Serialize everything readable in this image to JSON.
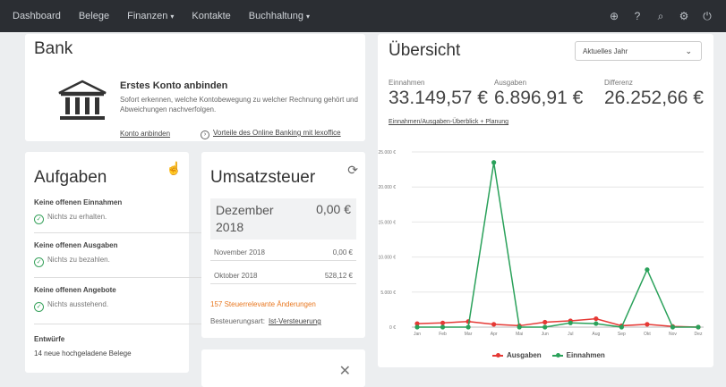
{
  "nav": {
    "items": [
      "Dashboard",
      "Belege",
      "Finanzen",
      "Kontakte",
      "Buchhaltung"
    ],
    "icons": [
      "plus-circle-icon",
      "help-icon",
      "search-icon",
      "settings-icon",
      "power-icon"
    ]
  },
  "bank": {
    "title": "Bank",
    "heading": "Erstes Konto anbinden",
    "description": "Sofort erkennen, welche Kontobewegung zu welcher Rechnung gehört und Abweichungen nachverfolgen.",
    "link_connect": "Konto anbinden",
    "link_online": "Vorteile des Online Banking mit lexoffice"
  },
  "aufgaben": {
    "title": "Aufgaben",
    "tasks": [
      {
        "title": "Keine offenen Einnahmen",
        "status": "Nichts zu erhalten."
      },
      {
        "title": "Keine offenen Ausgaben",
        "status": "Nichts zu bezahlen."
      },
      {
        "title": "Keine offenen Angebote",
        "status": "Nichts ausstehend."
      }
    ],
    "entwuerfe_title": "Entwürfe",
    "entwuerfe_value": "14  neue hochgeladene Belege"
  },
  "ust": {
    "title": "Umsatzsteuer",
    "current_month": "Dezember 2018",
    "current_value": "0,00 €",
    "rows": [
      {
        "label": "November 2018",
        "value": "0,00 €"
      },
      {
        "label": "Oktober 2018",
        "value": "528,12 €"
      }
    ],
    "link": "157 Steuerrelevante Änderungen",
    "besteuerung_label": "Besteuerungsart:",
    "besteuerung_value": "Ist-Versteuerung"
  },
  "uebersicht": {
    "title": "Übersicht",
    "select_value": "Aktuelles Jahr",
    "kpis": [
      {
        "label": "Einnahmen",
        "value": "33.149,57 €"
      },
      {
        "label": "Ausgaben",
        "value": "6.896,91 €"
      },
      {
        "label": "Differenz",
        "value": "26.252,66 €"
      }
    ],
    "link": "Einnahmen/Ausgaben-Überblick + Planung"
  },
  "colors": {
    "einnahmen": "#2aa15a",
    "ausgaben": "#e53935",
    "accent_orange": "#e8771f"
  },
  "chart_data": {
    "type": "line",
    "categories": [
      "Jan",
      "Feb",
      "Mar",
      "Apr",
      "Mai",
      "Jun",
      "Jul",
      "Aug",
      "Sep",
      "Okt",
      "Nov",
      "Dez"
    ],
    "ylim": [
      0,
      25000
    ],
    "yticks": [
      "0 €",
      "5.000 €",
      "10.000 €",
      "15.000 €",
      "20.000 €",
      "25.000 €"
    ],
    "series": [
      {
        "name": "Ausgaben",
        "color": "#e53935",
        "values": [
          500,
          600,
          800,
          400,
          200,
          700,
          900,
          1200,
          200,
          400,
          100,
          0
        ]
      },
      {
        "name": "Einnahmen",
        "color": "#2aa15a",
        "values": [
          0,
          0,
          0,
          23500,
          0,
          0,
          600,
          500,
          0,
          8200,
          0,
          0
        ]
      }
    ]
  }
}
